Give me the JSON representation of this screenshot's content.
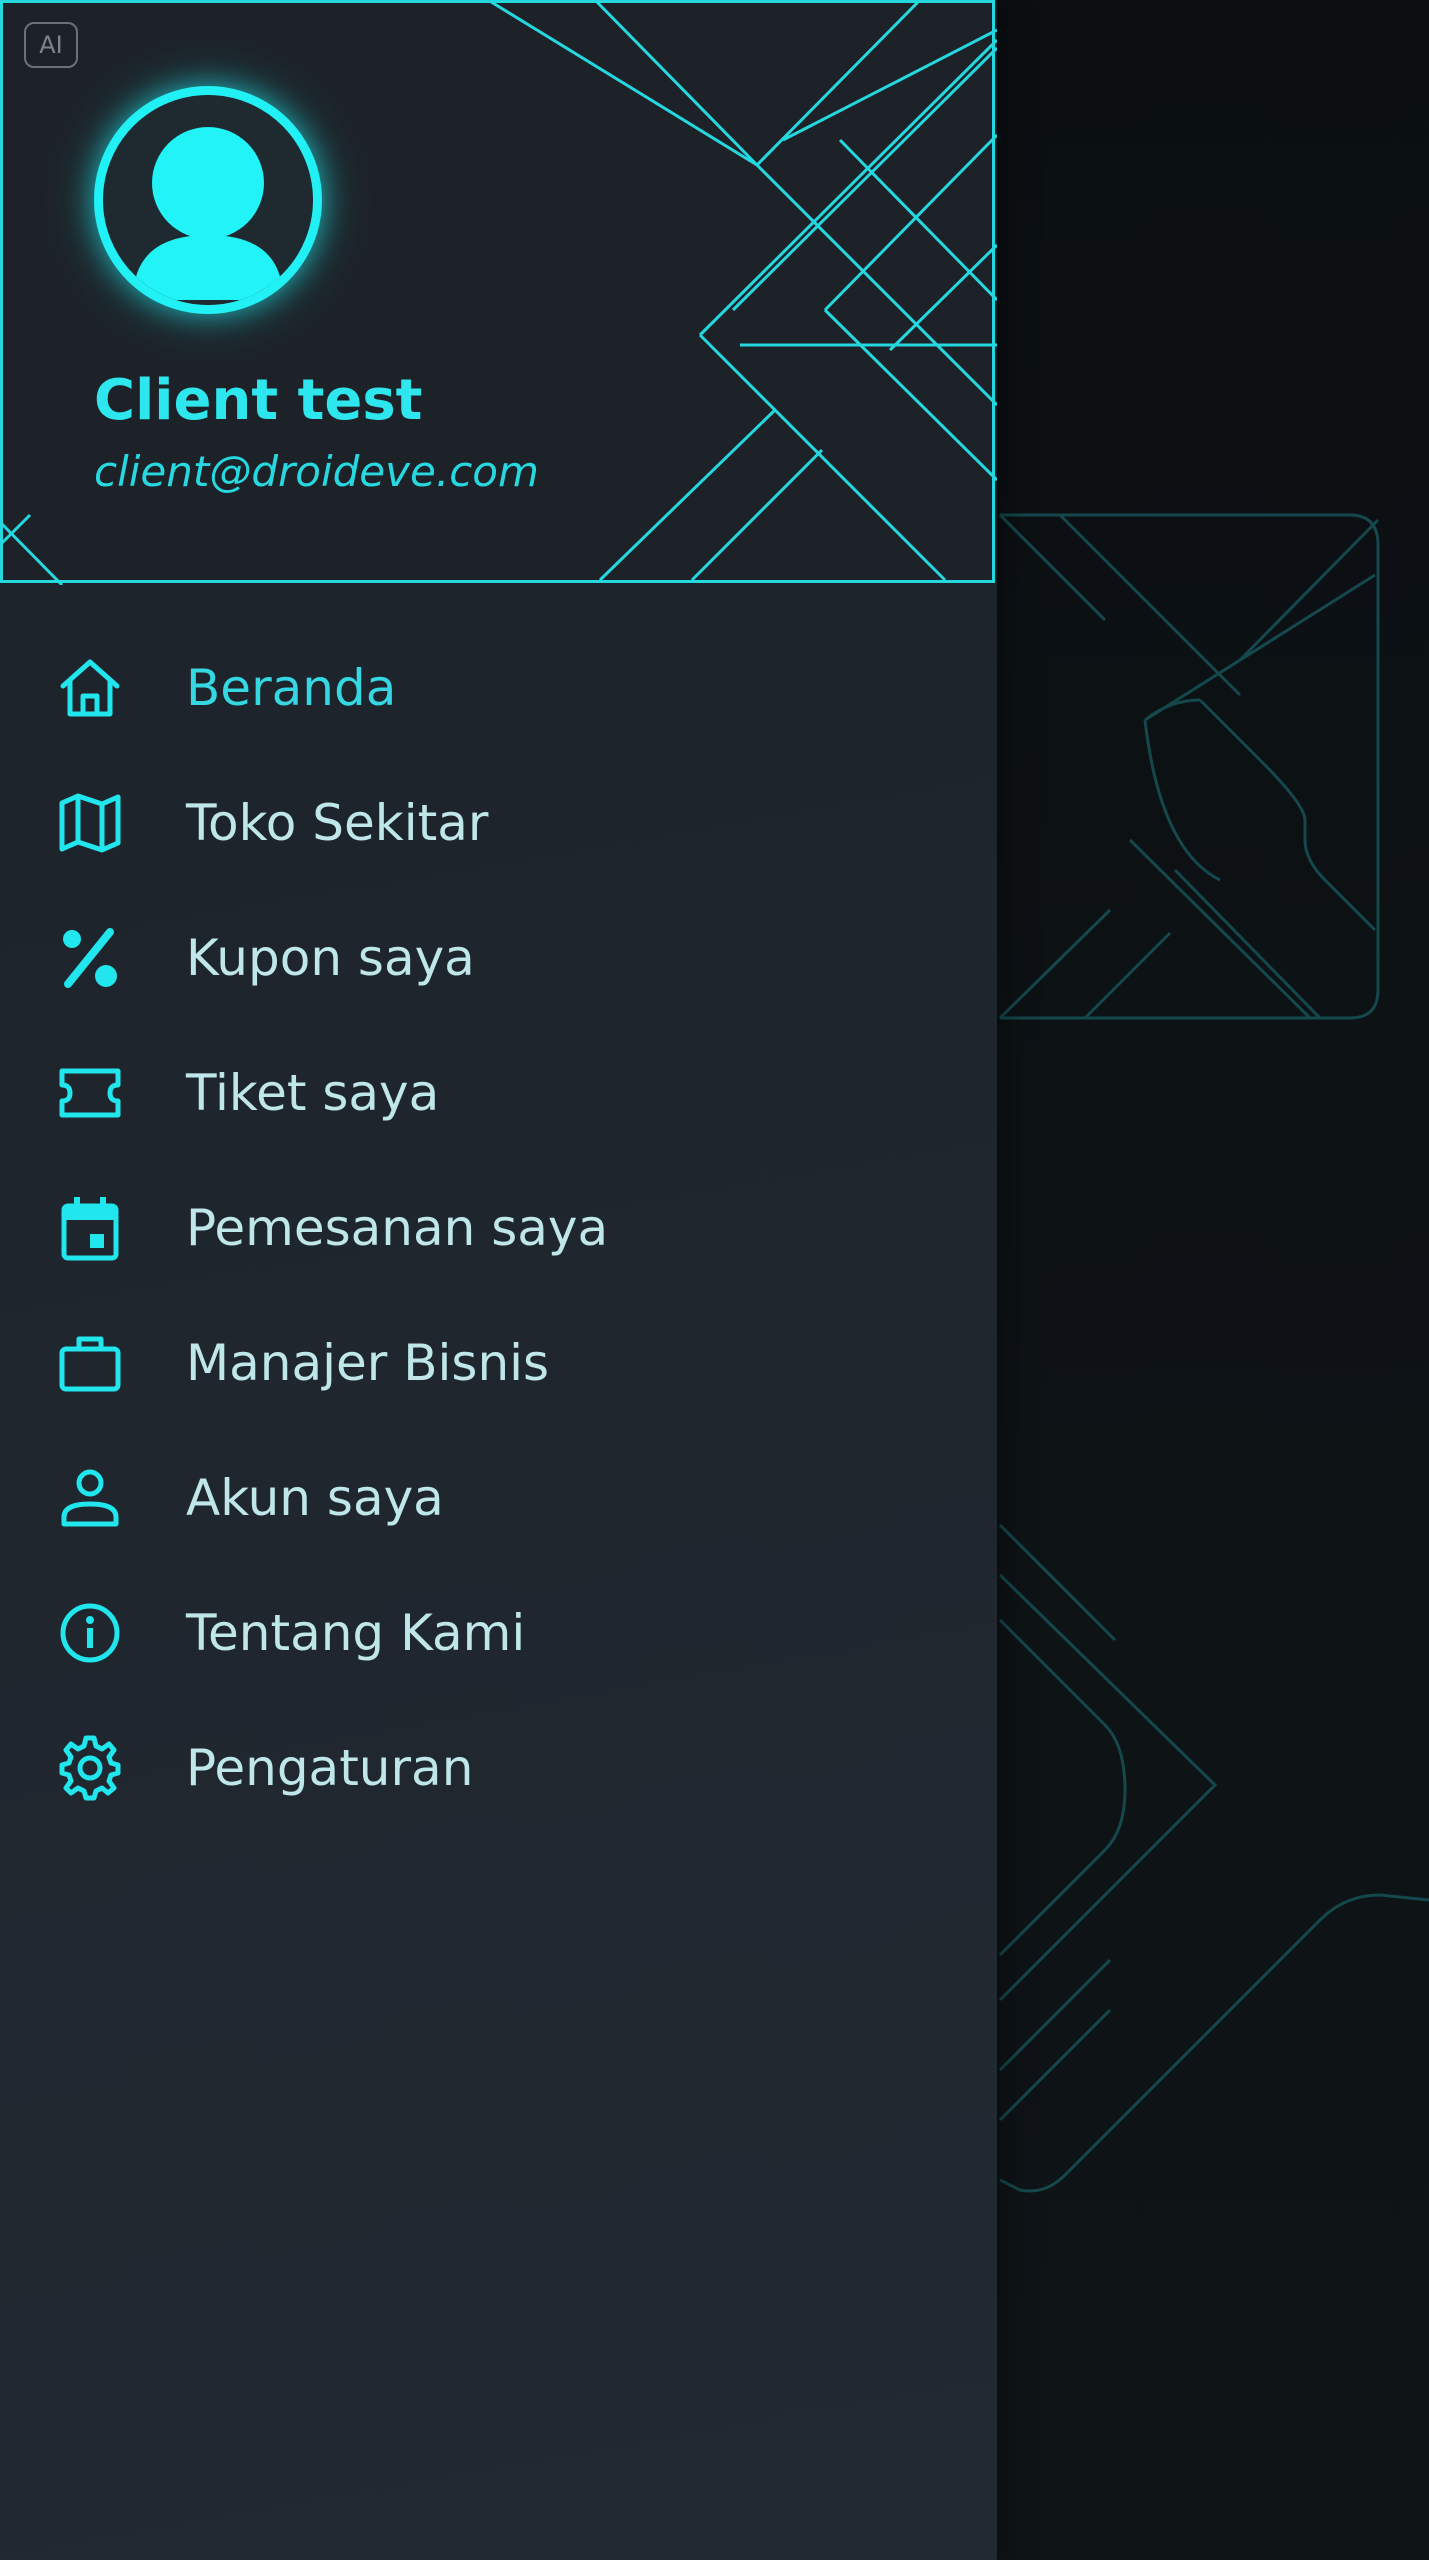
{
  "profile": {
    "name": "Client test",
    "email": "client@droideve.com",
    "avatar_icon": "user-avatar-icon"
  },
  "badge": {
    "label": "AI"
  },
  "menu": {
    "items": [
      {
        "label": "Beranda",
        "icon": "home-icon",
        "active": true
      },
      {
        "label": "Toko Sekitar",
        "icon": "map-icon",
        "active": false
      },
      {
        "label": "Kupon saya",
        "icon": "percent-icon",
        "active": false
      },
      {
        "label": "Tiket saya",
        "icon": "ticket-icon",
        "active": false
      },
      {
        "label": "Pemesanan saya",
        "icon": "calendar-icon",
        "active": false
      },
      {
        "label": "Manajer Bisnis",
        "icon": "briefcase-icon",
        "active": false
      },
      {
        "label": "Akun saya",
        "icon": "person-icon",
        "active": false
      },
      {
        "label": "Tentang Kami",
        "icon": "info-icon",
        "active": false
      },
      {
        "label": "Pengaturan",
        "icon": "gear-icon",
        "active": false
      }
    ]
  },
  "colors": {
    "accent": "#21f0f5",
    "active_label": "#35d8e2",
    "label": "#bfe7ea",
    "drawer_bg": "#1f262e",
    "overlay_bg": "#0c1013"
  }
}
